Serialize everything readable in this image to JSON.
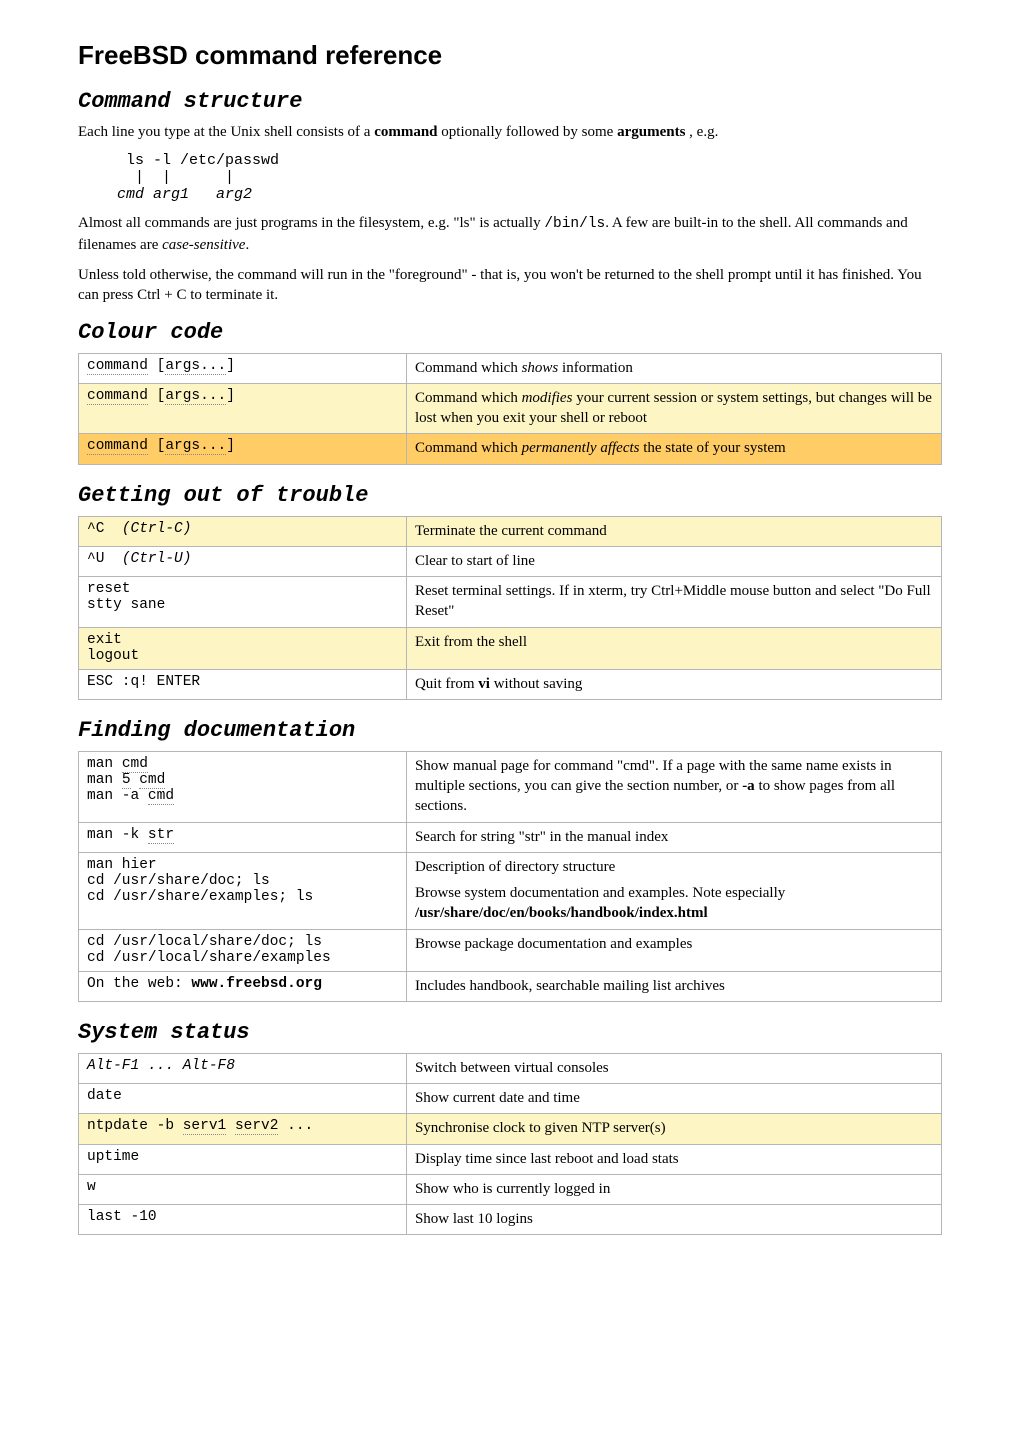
{
  "title": "FreeBSD command reference",
  "s1": {
    "heading": "Command structure",
    "intro_a": "Each line you type at the Unix shell consists of a ",
    "intro_b": "command",
    "intro_c": " optionally followed by some ",
    "intro_d": "arguments",
    "intro_e": " , e.g.",
    "example_l1": "  ls -l /etc/passwd",
    "example_l2": "   |  |      |",
    "example_l3": " cmd arg1   arg2",
    "p2_a": "Almost all commands are just programs in the filesystem, e.g. \"ls\" is actually ",
    "p2_b": "/bin/ls",
    "p2_c": ". A few are built-in to the shell. All commands and filenames are ",
    "p2_d": "case-sensitive",
    "p2_e": ".",
    "p3": "Unless told otherwise, the command will run in the \"foreground\" - that is, you won't be returned to the shell prompt until it has finished. You can press Ctrl + C to terminate it."
  },
  "s2": {
    "heading": "Colour code",
    "r1_cmd_a": "command",
    "r1_cmd_b": " [",
    "r1_cmd_c": "args...",
    "r1_cmd_d": "]",
    "r1_desc_a": "Command which ",
    "r1_desc_b": "shows",
    "r1_desc_c": " information",
    "r2_cmd_a": "command",
    "r2_cmd_b": " [",
    "r2_cmd_c": "args...",
    "r2_cmd_d": "]",
    "r2_desc_a": "Command which ",
    "r2_desc_b": "modifies",
    "r2_desc_c": " your current session or system settings, but changes will be lost when you exit your shell or reboot",
    "r3_cmd_a": "command",
    "r3_cmd_b": " [",
    "r3_cmd_c": "args...",
    "r3_cmd_d": "]",
    "r3_desc_a": "Command which ",
    "r3_desc_b": "permanently affects",
    "r3_desc_c": " the state of your system"
  },
  "s3": {
    "heading": "Getting out of trouble",
    "r1_cmd_a": "^C  ",
    "r1_cmd_b": "(Ctrl-C)",
    "r1_desc": "Terminate the current command",
    "r2_cmd_a": "^U  ",
    "r2_cmd_b": "(Ctrl-U)",
    "r2_desc": "Clear to start of line",
    "r3_cmd": "reset\nstty sane",
    "r3_desc": "Reset terminal settings. If in xterm, try Ctrl+Middle mouse button and select \"Do Full Reset\"",
    "r4_cmd": "exit\nlogout",
    "r4_desc": "Exit from the shell",
    "r5_cmd": "ESC :q! ENTER",
    "r5_desc_a": "Quit from ",
    "r5_desc_b": "vi",
    "r5_desc_c": " without saving"
  },
  "s4": {
    "heading": "Finding documentation",
    "r1_l1a": "man ",
    "r1_l1b": "cmd",
    "r1_l2a": "man ",
    "r1_l2b": "5",
    "r1_l2c": " ",
    "r1_l2d": "cmd",
    "r1_l3a": "man -a ",
    "r1_l3b": "cmd",
    "r1_desc_a": "Show manual page for command \"cmd\". If a page with the same name exists in multiple sections, you can give the section number, or ",
    "r1_desc_b": "-a",
    "r1_desc_c": " to show pages from all sections.",
    "r2_cmd_a": "man -k ",
    "r2_cmd_b": "str",
    "r2_desc": "Search for string \"str\" in the manual index",
    "r3_l1": "man hier",
    "r3_l2": "cd /usr/share/doc; ls",
    "r3_l3": "cd /usr/share/examples; ls",
    "r3_desc_a": "Description of directory structure",
    "r3_desc_b": "Browse system documentation and examples. Note especially ",
    "r3_desc_c": "/usr/share/doc/en/books/handbook/index.html",
    "r4_l1": "cd /usr/local/share/doc; ls",
    "r4_l2": "cd /usr/local/share/examples",
    "r4_desc": "Browse package documentation and examples",
    "r5_cmd_a": "On the web: ",
    "r5_cmd_b": "www.freebsd.org",
    "r5_desc": "Includes handbook, searchable mailing list archives"
  },
  "s5": {
    "heading": "System status",
    "r1_cmd": "Alt-F1 ... Alt-F8",
    "r1_desc": "Switch between virtual consoles",
    "r2_cmd": "date",
    "r2_desc": "Show current date and time",
    "r3_cmd_a": "ntpdate -b ",
    "r3_cmd_b": "serv1",
    "r3_cmd_c": " ",
    "r3_cmd_d": "serv2",
    "r3_cmd_e": " ...",
    "r3_desc": "Synchronise clock to given NTP server(s)",
    "r4_cmd": "uptime",
    "r4_desc": "Display time since last reboot and load stats",
    "r5_cmd": "w",
    "r5_desc": "Show who is currently logged in",
    "r6_cmd": "last -10",
    "r6_desc": "Show last 10 logins"
  }
}
